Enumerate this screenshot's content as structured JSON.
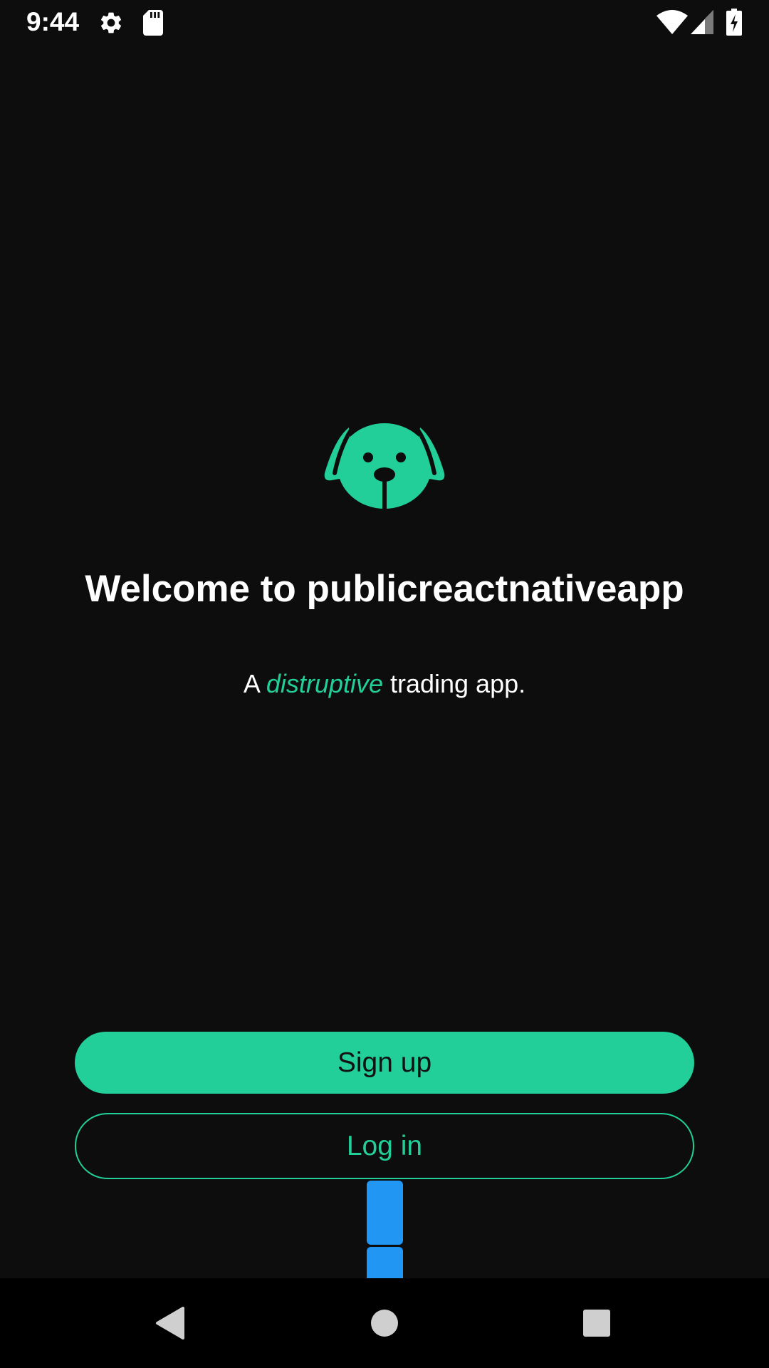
{
  "status_bar": {
    "time": "9:44",
    "icons": [
      "gear-icon",
      "sd-card-icon",
      "wifi-icon",
      "signal-icon",
      "battery-charging-icon"
    ]
  },
  "welcome": {
    "logo": "dog-face-icon",
    "title": "Welcome to publicreactnativeapp",
    "tagline_prefix": "A",
    "tagline_accent": "distruptive",
    "tagline_suffix": "trading app."
  },
  "actions": {
    "signup_label": "Sign up",
    "login_label": "Log in"
  },
  "nav_bar": {
    "icons": [
      "back-icon",
      "home-icon",
      "recents-icon"
    ]
  },
  "colors": {
    "background": "#0d0d0d",
    "accent": "#22cf99",
    "handle": "#2196f3",
    "nav_background": "#000000"
  }
}
